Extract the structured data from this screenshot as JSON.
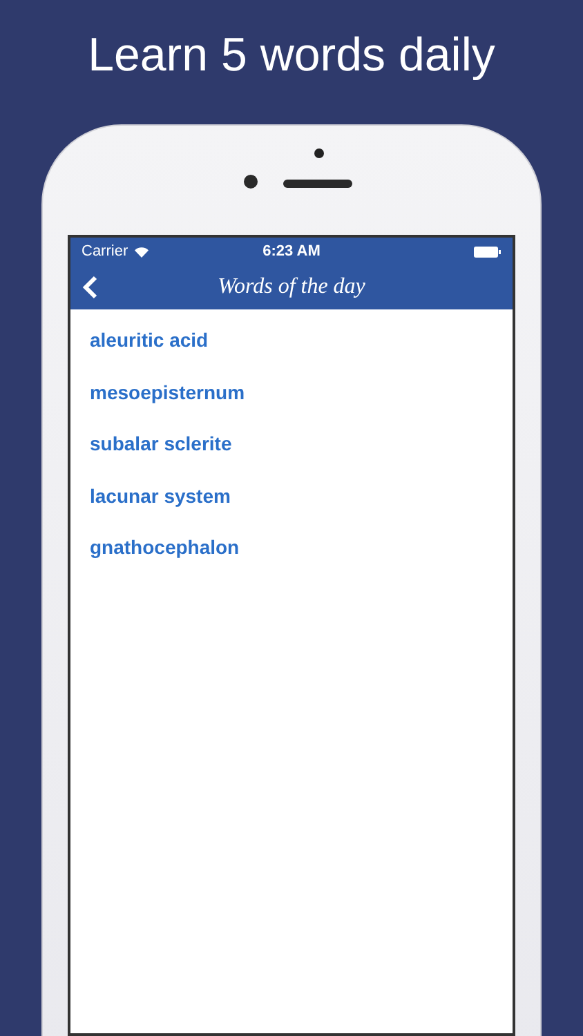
{
  "headline": "Learn 5 words daily",
  "status_bar": {
    "carrier": "Carrier",
    "time": "6:23 AM"
  },
  "nav_bar": {
    "title": "Words of the day"
  },
  "words": [
    {
      "text": "aleuritic acid"
    },
    {
      "text": "mesoepisternum"
    },
    {
      "text": "subalar sclerite"
    },
    {
      "text": "lacunar system"
    },
    {
      "text": "gnathocephalon"
    }
  ]
}
